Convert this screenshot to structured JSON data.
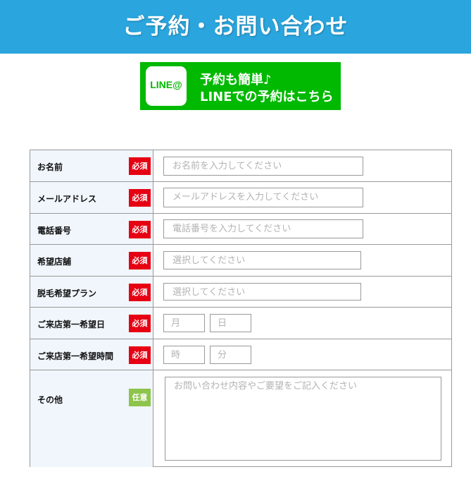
{
  "header": {
    "title": "ご予約・お問い合わせ"
  },
  "line_banner": {
    "logo_text": "LINE@",
    "line1": "予約も簡単♪",
    "line2": "LINEでの予約はこちら"
  },
  "badges": {
    "required": "必須",
    "optional": "任意"
  },
  "form": {
    "name": {
      "label": "お名前",
      "placeholder": "お名前を入力してください"
    },
    "email": {
      "label": "メールアドレス",
      "placeholder": "メールアドレスを入力してください"
    },
    "phone": {
      "label": "電話番号",
      "placeholder": "電話番号を入力してください"
    },
    "store": {
      "label": "希望店舗",
      "placeholder": "選択してください"
    },
    "plan": {
      "label": "脱毛希望プラン",
      "placeholder": "選択してください"
    },
    "visit_date": {
      "label": "ご来店第一希望日",
      "month_placeholder": "月",
      "day_placeholder": "日"
    },
    "visit_time": {
      "label": "ご来店第一希望時間",
      "hour_placeholder": "時",
      "minute_placeholder": "分"
    },
    "other": {
      "label": "その他",
      "placeholder": "お問い合わせ内容やご要望をご記入ください"
    }
  },
  "colors": {
    "header": "#2aa5dd",
    "line_green": "#00b900",
    "required_badge": "#e60012",
    "optional_badge": "#8dc44b",
    "label_bg": "#f0f6fc"
  }
}
